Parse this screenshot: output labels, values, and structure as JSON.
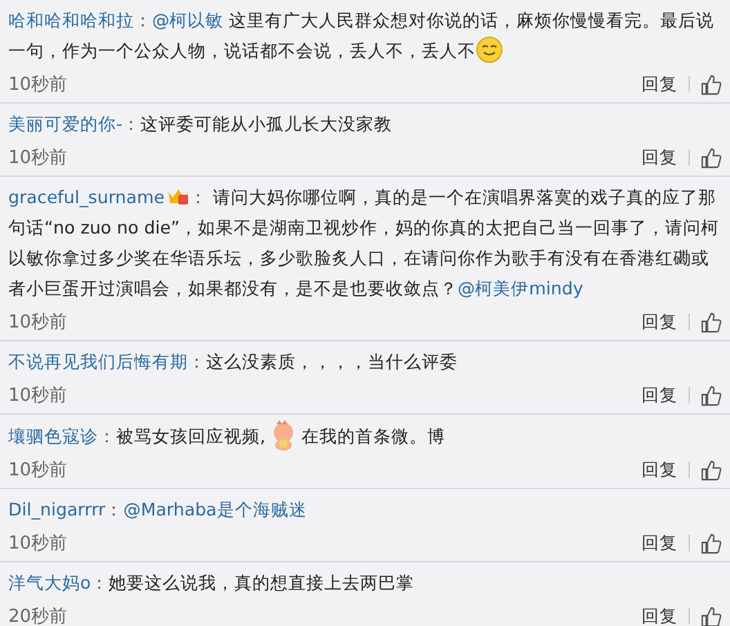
{
  "comments": [
    {
      "user": "哈和哈和哈和拉",
      "vip": false,
      "sep": "：",
      "body": [
        {
          "kind": "mention",
          "text": "@柯以敏"
        },
        {
          "kind": "text",
          "text": " 这里有广大人民群众想对你说的话，麻烦你慢慢看完。最后说一句，作为一个公众人物，说话都不会说，丢人不，丢人不"
        },
        {
          "kind": "smiley"
        }
      ],
      "time": "10秒前",
      "reply": "回复"
    },
    {
      "user": "美丽可爱的你-",
      "vip": false,
      "sep": "：",
      "body": [
        {
          "kind": "text",
          "text": "这评委可能从小孤儿长大没家教"
        }
      ],
      "time": "10秒前",
      "reply": "回复"
    },
    {
      "user": "graceful_surname",
      "vip": true,
      "sep": "：",
      "body": [
        {
          "kind": "text",
          "text": " 请问大妈你哪位啊，真的是一个在演唱界落寞的戏子真的应了那句话“no zuo no die”，如果不是湖南卫视炒作，妈的你真的太把自己当一回事了，请问柯以敏你拿过多少奖在华语乐坛，多少歌脸炙人口，在请问你作为歌手有没有在香港红磡或者小巨蛋开过演唱会，如果都没有，是不是也要收敛点？"
        },
        {
          "kind": "mention",
          "text": "@柯美伊mindy"
        }
      ],
      "time": "10秒前",
      "reply": "回复"
    },
    {
      "user": "不说再见我们后悔有期",
      "vip": false,
      "sep": "：",
      "body": [
        {
          "kind": "text",
          "text": "这么没素质，，，，当什么评委"
        }
      ],
      "time": "10秒前",
      "reply": "回复"
    },
    {
      "user": "壤驷色寇诊",
      "vip": false,
      "sep": "：",
      "body": [
        {
          "kind": "text",
          "text": "被骂女孩回应视频,"
        },
        {
          "kind": "sticker"
        },
        {
          "kind": "text",
          "text": "在我的首条微。博"
        }
      ],
      "time": "10秒前",
      "reply": "回复"
    },
    {
      "user": "Dil_nigarrrr",
      "vip": false,
      "sep": "：",
      "body": [
        {
          "kind": "mention",
          "text": "@Marhaba是个海贼迷"
        }
      ],
      "time": "10秒前",
      "reply": "回复"
    },
    {
      "user": "洋气大妈o",
      "vip": false,
      "sep": "：",
      "body": [
        {
          "kind": "text",
          "text": "她要这么说我，真的想直接上去两巴掌"
        }
      ],
      "time": "20秒前",
      "reply": "回复"
    }
  ]
}
